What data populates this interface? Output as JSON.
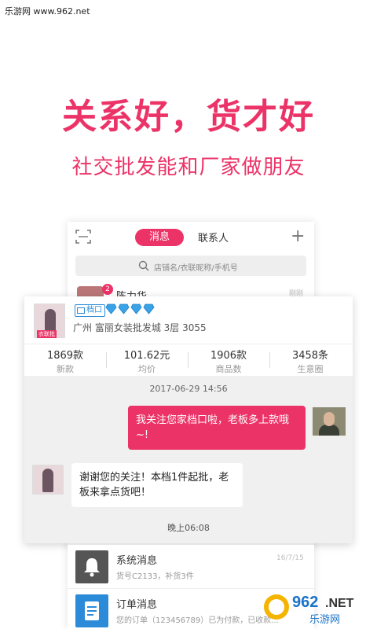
{
  "watermark": {
    "top_text": "乐游网 www.962.net",
    "logo_num": "962",
    "logo_suffix": ".NET",
    "logo_text": "乐游网"
  },
  "hero": {
    "headline": "关系好，货才好",
    "subline": "社交批发能和厂家做朋友"
  },
  "phone": {
    "tabs": {
      "messages": "消息",
      "contacts": "联系人"
    },
    "search_placeholder": "店铺名/衣联昵称/手机号",
    "peek_item": {
      "badge": "2",
      "name": "陈力华",
      "time": "刚刚"
    }
  },
  "chat": {
    "store": {
      "badge": "档口",
      "avatar_label": "衣联批",
      "diamond_count": 4,
      "location": "广州  富丽女装批发城 3层 3055",
      "stats": [
        {
          "value": "1869款",
          "label": "新款"
        },
        {
          "value": "101.62元",
          "label": "均价"
        },
        {
          "value": "1906款",
          "label": "商品数"
        },
        {
          "value": "3458条",
          "label": "生意圈"
        }
      ]
    },
    "date": "2017-06-29 14:56",
    "outgoing": "我关注您家档口啦，老板多上款哦~!",
    "incoming": "谢谢您的关注！本档1件起批，老板来拿点货吧！",
    "time": "晚上06:08"
  },
  "list": [
    {
      "title": "系统消息",
      "subtitle": "货号C2133，补货3件",
      "time": "16/7/15",
      "icon": "bell-icon",
      "color": "#555555"
    },
    {
      "title": "订单消息",
      "subtitle": "您的订单（123456789）已为付款，已收款...",
      "time": "",
      "icon": "document-icon",
      "color": "#2c8bd8"
    }
  ],
  "colors": {
    "accent": "#ec3367",
    "blue": "#2c8bd8"
  }
}
